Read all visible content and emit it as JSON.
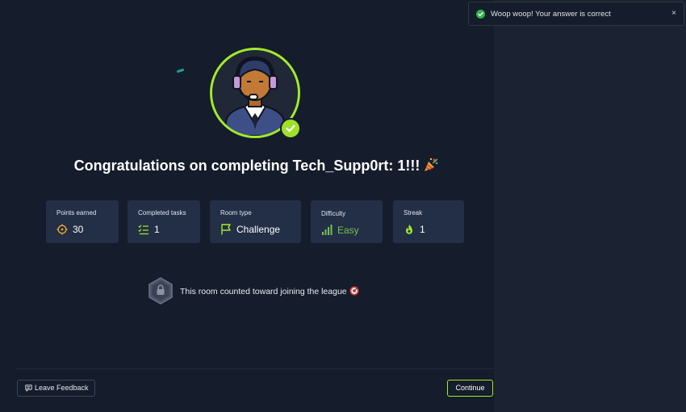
{
  "toast": {
    "message": "Woop woop! Your answer is correct",
    "close_label": "×"
  },
  "headline": {
    "text": "Congratulations on completing Tech_Supp0rt: 1!!!",
    "emoji_icon": "party-popper-icon"
  },
  "stats": [
    {
      "label": "Points earned",
      "value": "30",
      "icon": "crosshair-icon"
    },
    {
      "label": "Completed tasks",
      "value": "1",
      "icon": "checklist-icon"
    },
    {
      "label": "Room type",
      "value": "Challenge",
      "icon": "flag-icon"
    },
    {
      "label": "Difficulty",
      "value": "Easy",
      "icon": "signal-bars-icon"
    },
    {
      "label": "Streak",
      "value": "1",
      "icon": "flame-icon"
    }
  ],
  "league": {
    "text": "This room counted toward joining the league",
    "icon": "lock-shield-icon",
    "emoji_icon": "target-icon"
  },
  "footer": {
    "feedback_label": "Leave Feedback",
    "continue_label": "Continue"
  },
  "colors": {
    "background": "#151c2b",
    "card": "#232e47",
    "accent_green": "#a3ea2a",
    "success": "#2fb34c",
    "easy": "#76c24a",
    "flame": "#a3ea2a"
  }
}
